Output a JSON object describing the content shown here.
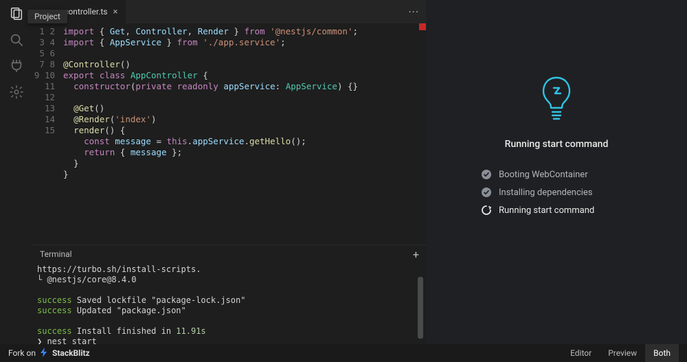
{
  "activity": {
    "project_label": "Project"
  },
  "tabs": {
    "active": {
      "filename": "app.controller.ts"
    },
    "more_label": "···"
  },
  "code": {
    "line1": "import { Get, Controller, Render } from '@nestjs/common';",
    "line1_str": "'@nestjs/common'",
    "line2": "import { AppService } from './app.service';",
    "line2_str": "'./app.service'",
    "line4": "@Controller()",
    "line5a": "export",
    "line5b": "class",
    "line5c": "AppController",
    "line6a": "constructor",
    "line6b": "private",
    "line6c": "readonly",
    "line6d": "appService",
    "line6e": "AppService",
    "line8": "@Get()",
    "line9a": "@Render",
    "line9b": "'index'",
    "line10": "render",
    "line11a": "const",
    "line11b": "message",
    "line11c": "this",
    "line11d": "appService",
    "line11e": "getHello",
    "line12a": "return",
    "line12b": "message"
  },
  "terminal": {
    "title": "Terminal",
    "l1": "https://turbo.sh/install-scripts.",
    "l2": "└ @nestjs/core@8.4.0",
    "l3a": "success",
    "l3b": " Saved lockfile \"package-lock.json\"",
    "l4a": "success",
    "l4b": " Updated \"package.json\"",
    "l5a": "success",
    "l5b": " Install finished in ",
    "l5c": "11.91s",
    "l6": "❯ nest start"
  },
  "preview": {
    "title": "Running start command",
    "steps": [
      {
        "label": "Booting WebContainer",
        "done": true
      },
      {
        "label": "Installing dependencies",
        "done": true
      },
      {
        "label": "Running start command",
        "done": false
      }
    ]
  },
  "footer": {
    "fork_prefix": "Fork on",
    "brand": "StackBlitz",
    "buttons": {
      "editor": "Editor",
      "preview": "Preview",
      "both": "Both"
    }
  }
}
